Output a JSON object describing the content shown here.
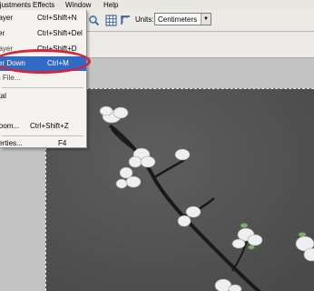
{
  "menubar": {
    "items": [
      {
        "label": "Adjustments"
      },
      {
        "label": "Effects"
      },
      {
        "label": "Window"
      },
      {
        "label": "Help"
      }
    ]
  },
  "toolbar": {
    "units_label": "Units:",
    "units_value": "Centimeters",
    "icons": [
      "zoom-icon",
      "grid-icon",
      "ruler-icon"
    ]
  },
  "dropdown": {
    "items": [
      {
        "label": "Layer",
        "shortcut": "Ctrl+Shift+N"
      },
      {
        "label": "yer",
        "shortcut": "Ctrl+Shift+Del"
      },
      {
        "label": "Layer",
        "shortcut": "Ctrl+Shift+D"
      },
      {
        "label": "yer Down",
        "shortcut": "Ctrl+M"
      },
      {
        "label": "m File...",
        "shortcut": ""
      },
      {
        "label": "ntal",
        "shortcut": ""
      },
      {
        "label": "al",
        "shortcut": ""
      },
      {
        "label": "Zoom...",
        "shortcut": "Ctrl+Shift+Z"
      },
      {
        "label": "perties...",
        "shortcut": "F4"
      }
    ]
  },
  "colors": {
    "highlight": "#3169c6",
    "annotation": "#d3263a"
  }
}
